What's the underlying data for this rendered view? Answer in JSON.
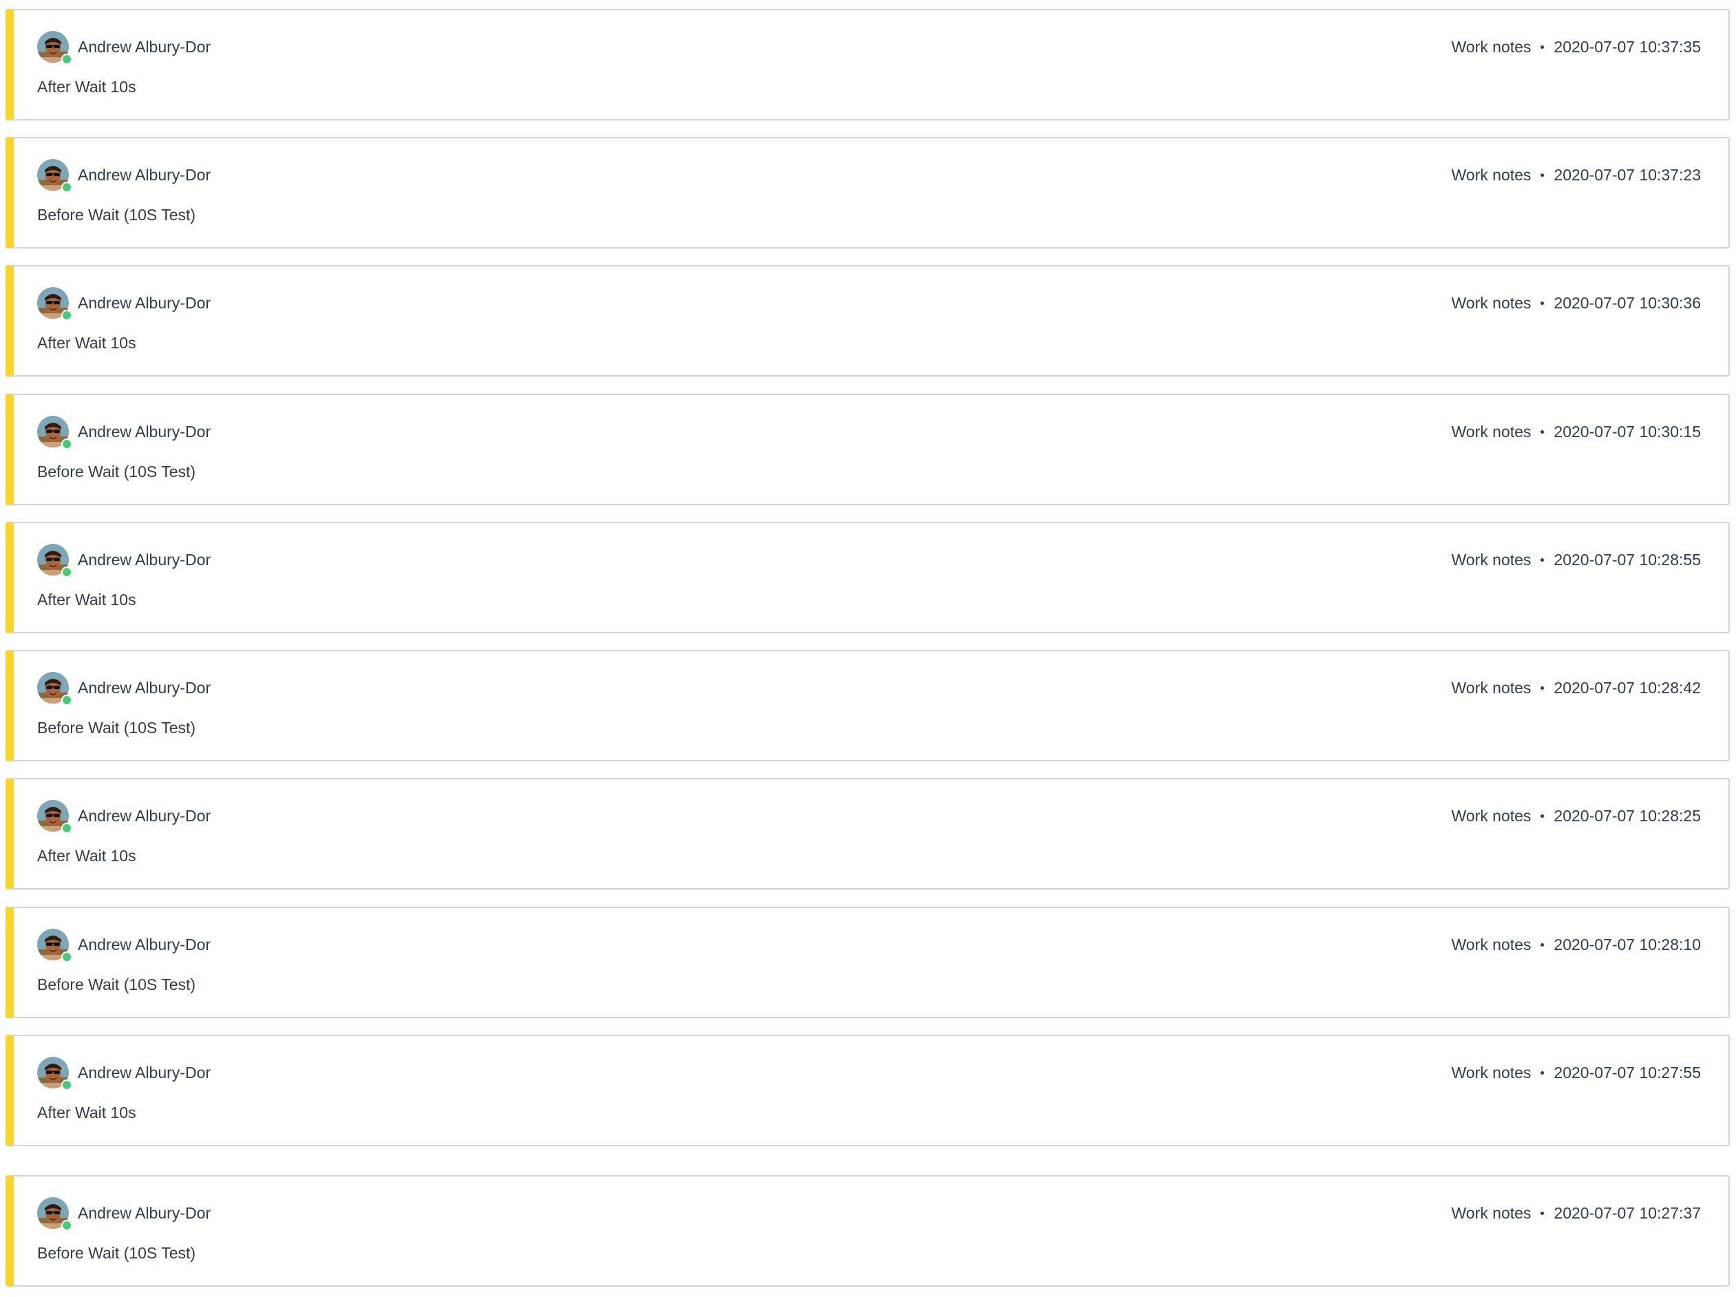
{
  "activity_stream": {
    "entries": [
      {
        "author": "Andrew Albury-Dor",
        "type": "Work notes",
        "timestamp": "2020-07-07 10:37:35",
        "text": "After Wait 10s"
      },
      {
        "author": "Andrew Albury-Dor",
        "type": "Work notes",
        "timestamp": "2020-07-07 10:37:23",
        "text": "Before Wait (10S Test)"
      },
      {
        "author": "Andrew Albury-Dor",
        "type": "Work notes",
        "timestamp": "2020-07-07 10:30:36",
        "text": "After Wait 10s"
      },
      {
        "author": "Andrew Albury-Dor",
        "type": "Work notes",
        "timestamp": "2020-07-07 10:30:15",
        "text": "Before Wait (10S Test)"
      },
      {
        "author": "Andrew Albury-Dor",
        "type": "Work notes",
        "timestamp": "2020-07-07 10:28:55",
        "text": "After Wait 10s"
      },
      {
        "author": "Andrew Albury-Dor",
        "type": "Work notes",
        "timestamp": "2020-07-07 10:28:42",
        "text": "Before Wait (10S Test)"
      },
      {
        "author": "Andrew Albury-Dor",
        "type": "Work notes",
        "timestamp": "2020-07-07 10:28:25",
        "text": "After Wait 10s"
      },
      {
        "author": "Andrew Albury-Dor",
        "type": "Work notes",
        "timestamp": "2020-07-07 10:28:10",
        "text": "Before Wait (10S Test)"
      },
      {
        "author": "Andrew Albury-Dor",
        "type": "Work notes",
        "timestamp": "2020-07-07 10:27:55",
        "text": "After Wait 10s"
      },
      {
        "author": "Andrew Albury-Dor",
        "type": "Work notes",
        "timestamp": "2020-07-07 10:27:37",
        "text": "Before Wait (10S Test)"
      }
    ]
  },
  "colors": {
    "work_notes_accent": "#f9d42a",
    "presence_online": "#4bc97a",
    "card_border": "#cfd4d8",
    "text": "#2e3d49"
  },
  "icons": {
    "avatar": "user-avatar-icon",
    "presence": "online-status-dot"
  }
}
